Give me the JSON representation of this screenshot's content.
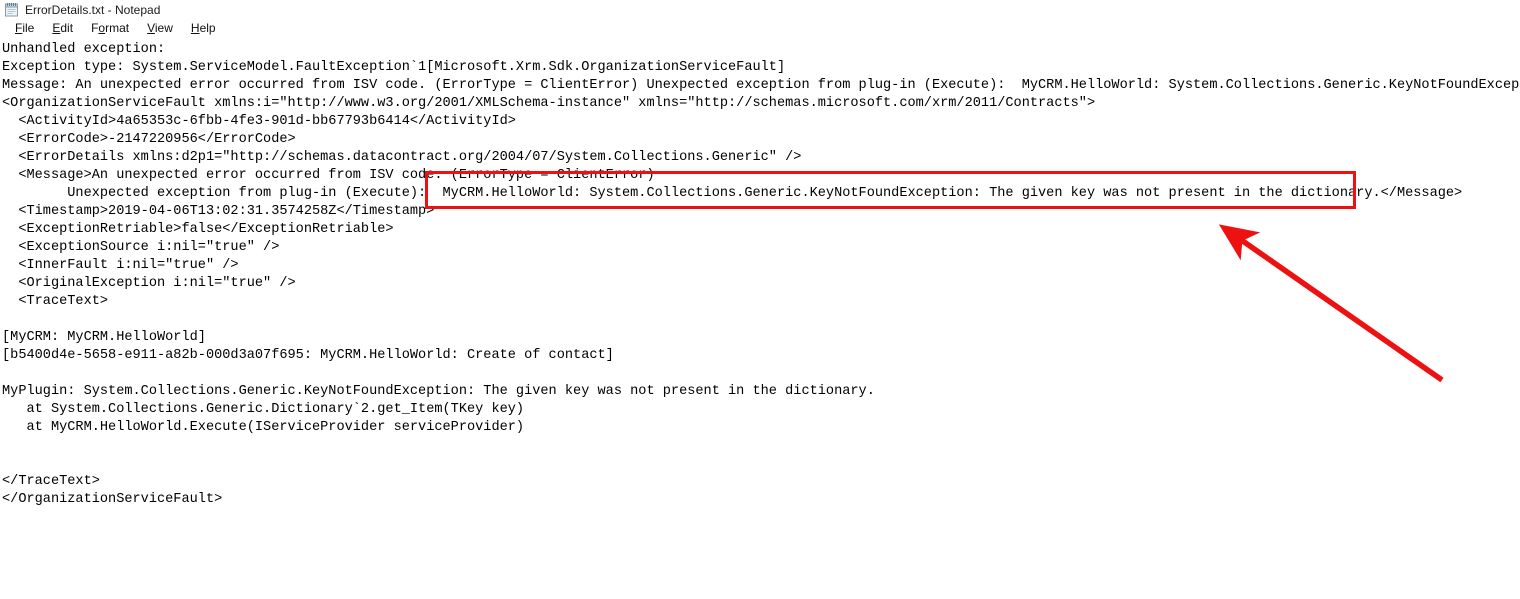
{
  "window": {
    "title": "ErrorDetails.txt - Notepad",
    "icon": "notepad-icon",
    "filename": "ErrorDetails.txt",
    "app": "Notepad"
  },
  "menu": {
    "items": [
      {
        "label": "File",
        "accesskey": "F"
      },
      {
        "label": "Edit",
        "accesskey": "E"
      },
      {
        "label": "Format",
        "accesskey": "o"
      },
      {
        "label": "View",
        "accesskey": "V"
      },
      {
        "label": "Help",
        "accesskey": "H"
      }
    ]
  },
  "document": {
    "lines": [
      "Unhandled exception:",
      "Exception type: System.ServiceModel.FaultException`1[Microsoft.Xrm.Sdk.OrganizationServiceFault]",
      "Message: An unexpected error occurred from ISV code. (ErrorType = ClientError) Unexpected exception from plug-in (Execute):  MyCRM.HelloWorld: System.Collections.Generic.KeyNotFoundException: The given key was not present in the dictionary.",
      "<OrganizationServiceFault xmlns:i=\"http://www.w3.org/2001/XMLSchema-instance\" xmlns=\"http://schemas.microsoft.com/xrm/2011/Contracts\">",
      "  <ActivityId>4a65353c-6fbb-4fe3-901d-bb67793b6414</ActivityId>",
      "  <ErrorCode>-2147220956</ErrorCode>",
      "  <ErrorDetails xmlns:d2p1=\"http://schemas.datacontract.org/2004/07/System.Collections.Generic\" />",
      "  <Message>An unexpected error occurred from ISV code. (ErrorType = ClientError)",
      "        Unexpected exception from plug-in (Execute):  MyCRM.HelloWorld: System.Collections.Generic.KeyNotFoundException: The given key was not present in the dictionary.</Message>",
      "  <Timestamp>2019-04-06T13:02:31.3574258Z</Timestamp>",
      "  <ExceptionRetriable>false</ExceptionRetriable>",
      "  <ExceptionSource i:nil=\"true\" />",
      "  <InnerFault i:nil=\"true\" />",
      "  <OriginalException i:nil=\"true\" />",
      "  <TraceText>",
      "",
      "[MyCRM: MyCRM.HelloWorld]",
      "[b5400d4e-5658-e911-a82b-000d3a07f695: MyCRM.HelloWorld: Create of contact]",
      "",
      "MyPlugin: System.Collections.Generic.KeyNotFoundException: The given key was not present in the dictionary.",
      "   at System.Collections.Generic.Dictionary`2.get_Item(TKey key)",
      "   at MyCRM.HelloWorld.Execute(IServiceProvider serviceProvider)",
      "",
      "",
      "</TraceText>",
      "</OrganizationServiceFault>"
    ]
  },
  "annotations": {
    "highlight_box": {
      "color": "#ee1111",
      "target_text": "MyCRM.HelloWorld: System.Collections.Generic.KeyNotFoundException: The given key was not present in the dictionary."
    },
    "arrow": {
      "color": "#ee1111",
      "points_to": "highlight-box"
    }
  },
  "colors": {
    "background": "#ffffff",
    "text": "#000000",
    "annotation": "#ee1111",
    "title_text": "#1b1b1b"
  }
}
